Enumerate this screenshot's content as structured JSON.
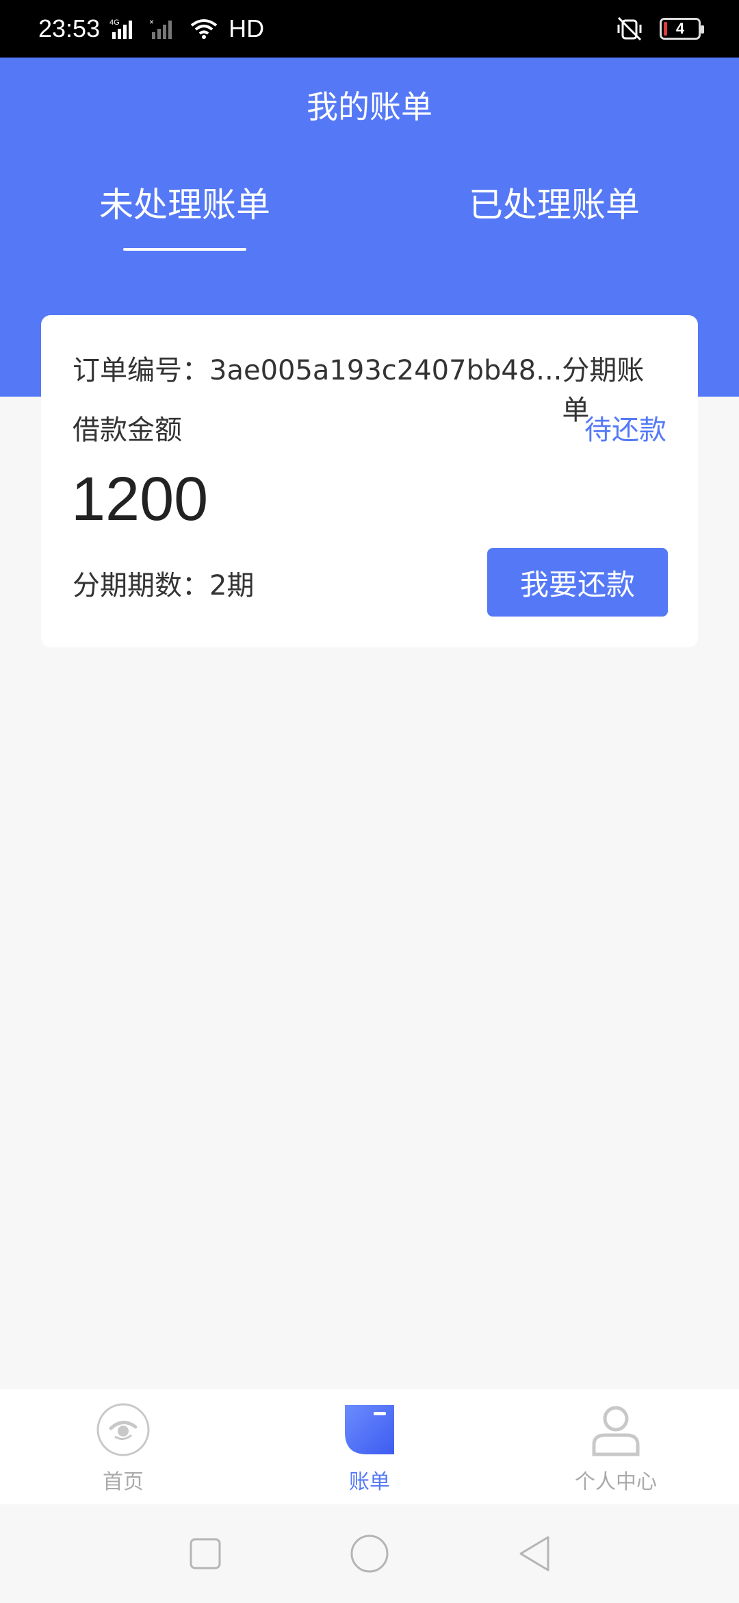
{
  "status_bar": {
    "time": "23:53",
    "network": "HD",
    "battery_level": "4",
    "icons": [
      "4g-signal-icon",
      "signal-x-icon",
      "wifi-icon",
      "hd-icon",
      "mute-icon",
      "battery-icon"
    ]
  },
  "header": {
    "title": "我的账单",
    "tabs": [
      {
        "label": "未处理账单",
        "active": true
      },
      {
        "label": "已处理账单",
        "active": false
      }
    ]
  },
  "bill_card": {
    "order_label": "订单编号：",
    "order_number": "3ae005a193c2407bb48...",
    "bill_type": "分期账单",
    "loan_label": "借款金额",
    "status": "待还款",
    "amount": "1200",
    "installments_label": "分期期数：",
    "installments_value": "2期",
    "pay_button_label": "我要还款"
  },
  "bottom_nav": {
    "items": [
      {
        "label": "首页",
        "icon": "home-icon",
        "active": false
      },
      {
        "label": "账单",
        "icon": "bill-icon",
        "active": true
      },
      {
        "label": "个人中心",
        "icon": "user-icon",
        "active": false
      }
    ]
  },
  "colors": {
    "accent": "#5579f6",
    "background": "#f7f7f7",
    "text": "#333333",
    "inactive": "#aaaaaa"
  }
}
